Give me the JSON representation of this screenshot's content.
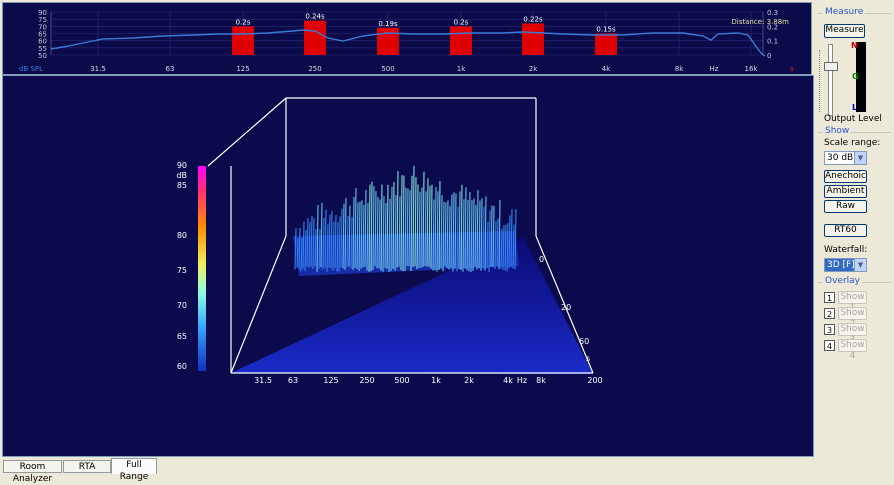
{
  "top_chart": {
    "y_left_ticks": [
      "90",
      "75",
      "70",
      "65",
      "60",
      "55",
      "50"
    ],
    "y_right_ticks": [
      "0.3",
      "0.2",
      "0.1",
      "0"
    ],
    "x_label": "dB SPL",
    "freq_ticks": [
      "31.5",
      "63",
      "125",
      "250",
      "500",
      "1k",
      "2k",
      "4k",
      "8k",
      "Hz",
      "16k"
    ],
    "x_end_label": "s",
    "distance": "Distance: 3.88m",
    "bars": [
      {
        "freq": "125",
        "label": "0.2s",
        "value": 0.2
      },
      {
        "freq": "250",
        "label": "0.24s",
        "value": 0.24
      },
      {
        "freq": "500",
        "label": "0.19s",
        "value": 0.19
      },
      {
        "freq": "1k",
        "label": "0.2s",
        "value": 0.2
      },
      {
        "freq": "2k",
        "label": "0.22s",
        "value": 0.22
      },
      {
        "freq": "4k",
        "label": "0.15s",
        "value": 0.15
      }
    ],
    "colors": {
      "bar": "#e00000",
      "curve": "#3a7bd5",
      "bg": "#0b0b4a"
    }
  },
  "waterfall": {
    "db_ticks": [
      "90",
      "85",
      "80",
      "75",
      "70",
      "65",
      "60"
    ],
    "db_label": "dB",
    "freq_ticks": [
      "31.5",
      "63",
      "125",
      "250",
      "500",
      "1k",
      "2k",
      "4k",
      "Hz",
      "8k",
      "200"
    ],
    "time_ticks": [
      "0",
      "",
      "20",
      "",
      "60",
      "s"
    ],
    "colors": {
      "bg": "#0a0a4c",
      "frame": "#ffffff"
    }
  },
  "sidebar": {
    "measure_group": "Measure",
    "measure_button": "Measure",
    "meter_top": "N",
    "meter_mid": "G",
    "meter_bot": "L",
    "output_level": "Output Level",
    "show_group": "Show",
    "scale_range_label": "Scale range:",
    "scale_range_value": "30 dB",
    "anechoic": "Anechoic",
    "ambient": "Ambient",
    "raw": "Raw",
    "rt60": "RT60",
    "waterfall_label": "Waterfall:",
    "waterfall_value": "3D [F]",
    "overlay_group": "Overlay",
    "overlays": [
      {
        "num": "1",
        "label": "Show 1"
      },
      {
        "num": "2",
        "label": "Show 2"
      },
      {
        "num": "3",
        "label": "Show 3"
      },
      {
        "num": "4",
        "label": "Show 4"
      }
    ]
  },
  "tabs": [
    "Room Analyzer",
    "RTA",
    "Full Range"
  ]
}
